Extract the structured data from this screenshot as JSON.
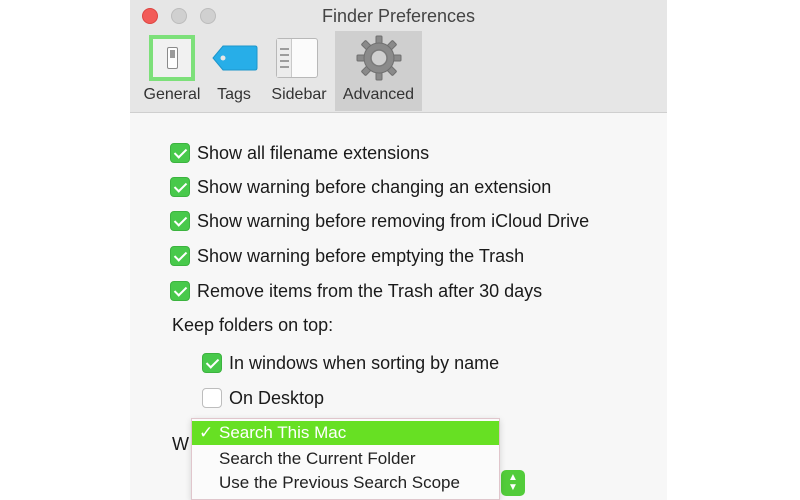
{
  "window": {
    "title": "Finder Preferences"
  },
  "tabs": [
    {
      "label": "General",
      "icon": "general-switch-icon"
    },
    {
      "label": "Tags",
      "icon": "tag-icon"
    },
    {
      "label": "Sidebar",
      "icon": "sidebar-icon"
    },
    {
      "label": "Advanced",
      "icon": "gear-icon",
      "selected": true
    }
  ],
  "options": [
    {
      "label": "Show all filename extensions",
      "checked": true
    },
    {
      "label": "Show warning before changing an extension",
      "checked": true
    },
    {
      "label": "Show warning before removing from iCloud Drive",
      "checked": true
    },
    {
      "label": "Show warning before emptying the Trash",
      "checked": true
    },
    {
      "label": "Remove items from the Trash after 30 days",
      "checked": true
    }
  ],
  "keep_folders": {
    "label": "Keep folders on top:",
    "options": [
      {
        "label": "In windows when sorting by name",
        "checked": true
      },
      {
        "label": "On Desktop",
        "checked": false
      }
    ]
  },
  "search": {
    "label_visible": "Wh",
    "menu": [
      {
        "label": "Search This Mac",
        "selected": true,
        "check": "✓"
      },
      {
        "label": "Search the Current Folder",
        "selected": false
      },
      {
        "label": "Use the Previous Search Scope",
        "selected": false
      }
    ]
  },
  "colors": {
    "checkbox_on": "#48c94b",
    "menu_highlight": "#67e023",
    "close_button": "#f25b58"
  }
}
